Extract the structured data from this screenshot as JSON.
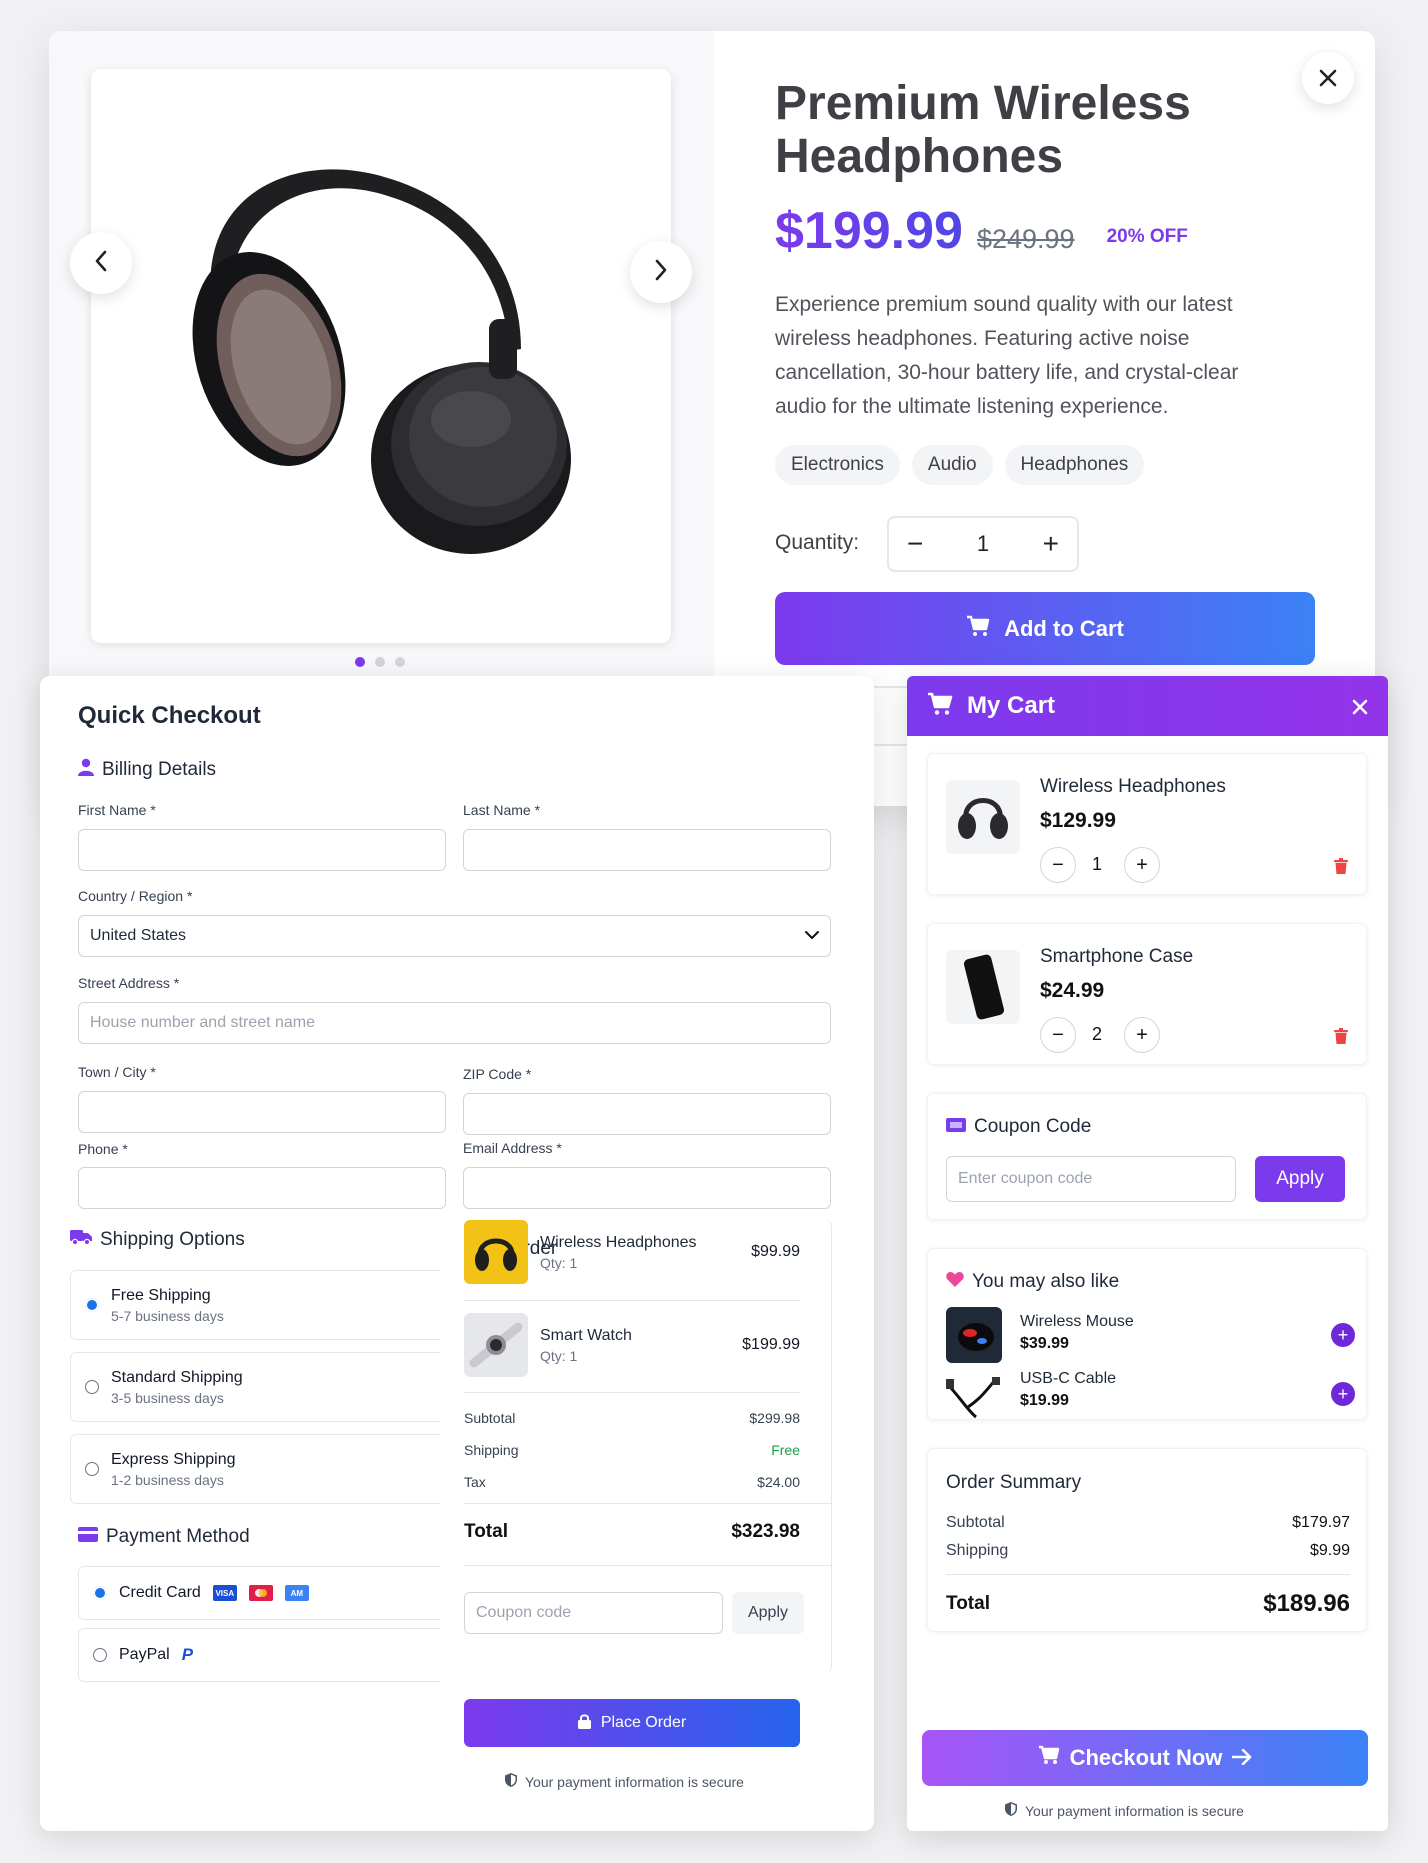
{
  "product": {
    "title": "Premium Wireless Headphones",
    "price": "$199.99",
    "old_price": "$249.99",
    "discount": "20% OFF",
    "description": "Experience premium sound quality with our latest wireless headphones. Featuring active noise cancellation, 30-hour battery life, and crystal-clear audio for the ultimate listening experience.",
    "tags": [
      "Electronics",
      "Audio",
      "Headphones"
    ],
    "quantity_label": "Quantity:",
    "quantity": "1",
    "add_to_cart": "Add to Cart",
    "gallery_slides": 3,
    "active_slide": 1
  },
  "checkout": {
    "title": "Quick Checkout",
    "billing_heading": "Billing Details",
    "first_name_label": "First Name *",
    "last_name_label": "Last Name *",
    "country_label": "Country / Region *",
    "country_value": "United States",
    "street_label": "Street Address *",
    "street_placeholder": "House number and street name",
    "town_label": "Town / City *",
    "zip_label": "ZIP Code *",
    "phone_label": "Phone *",
    "email_label": "Email Address *",
    "shipping_heading": "Shipping Options",
    "shipping_options": [
      {
        "name": "Free Shipping",
        "time": "5-7 business days",
        "selected": true
      },
      {
        "name": "Standard Shipping",
        "time": "3-5 business days",
        "selected": false
      },
      {
        "name": "Express Shipping",
        "time": "1-2 business days",
        "selected": false
      }
    ],
    "payment_heading": "Payment Method",
    "payment_options": [
      {
        "name": "Credit Card",
        "selected": true
      },
      {
        "name": "PayPal",
        "selected": false
      }
    ],
    "order_heading": "Your Order",
    "order_items": [
      {
        "name": "Wireless Headphones",
        "qty": "Qty: 1",
        "price": "$99.99"
      },
      {
        "name": "Smart Watch",
        "qty": "Qty: 1",
        "price": "$199.99"
      }
    ],
    "subtotal_label": "Subtotal",
    "subtotal": "$299.98",
    "shipping_label": "Shipping",
    "shipping": "Free",
    "tax_label": "Tax",
    "tax": "$24.00",
    "total_label": "Total",
    "total": "$323.98",
    "coupon_placeholder": "Coupon code",
    "apply": "Apply",
    "place_order": "Place Order",
    "secure_note": "Your payment information is secure"
  },
  "cart": {
    "title": "My Cart",
    "items": [
      {
        "name": "Wireless Headphones",
        "price": "$129.99",
        "qty": "1"
      },
      {
        "name": "Smartphone Case",
        "price": "$24.99",
        "qty": "2"
      }
    ],
    "coupon_heading": "Coupon Code",
    "coupon_placeholder": "Enter coupon code",
    "apply": "Apply",
    "recommend_heading": "You may also like",
    "recommendations": [
      {
        "name": "Wireless Mouse",
        "price": "$39.99"
      },
      {
        "name": "USB-C Cable",
        "price": "$19.99"
      }
    ],
    "summary_heading": "Order Summary",
    "subtotal_label": "Subtotal",
    "subtotal": "$179.97",
    "shipping_label": "Shipping",
    "shipping": "$9.99",
    "total_label": "Total",
    "total": "$189.96",
    "checkout_now": "Checkout Now",
    "secure_note": "Your payment information is secure"
  },
  "colors": {
    "accent": "#7c3aed",
    "accent_blue": "#3b82f6",
    "success": "#16a34a",
    "danger": "#ef4444",
    "heart": "#ec4899"
  },
  "icons": [
    "chevron-left-icon",
    "chevron-right-icon",
    "close-icon",
    "cart-icon",
    "user-icon",
    "chevron-down-icon",
    "truck-icon",
    "credit-card-icon",
    "lock-icon",
    "shield-icon",
    "ticket-icon",
    "heart-icon",
    "trash-icon",
    "plus-icon",
    "minus-icon",
    "arrow-right-icon",
    "paypal-icon",
    "visa-icon",
    "mastercard-icon",
    "amex-icon"
  ]
}
